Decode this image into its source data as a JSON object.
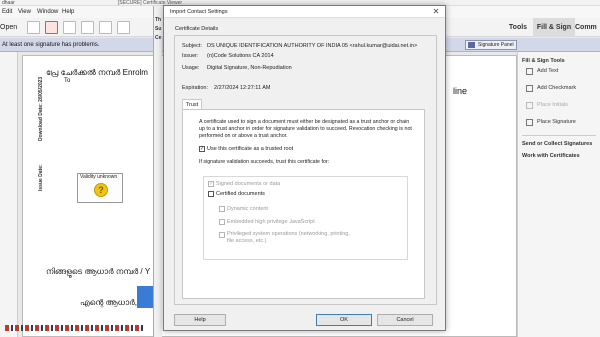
{
  "app": {
    "title_fragment": "dhaar",
    "cert_viewer_fragment": "[SECURE] Certificate Viewer",
    "menu": [
      "Edit",
      "View",
      "Window",
      "Help"
    ],
    "open_label": "Open",
    "tabs": [
      "Tools",
      "Fill & Sign",
      "Comm"
    ],
    "signature_message": "At least one signature has problems.",
    "signature_panel_label": "Signature Panel"
  },
  "document": {
    "header_line": "പ്രേ ചേർക്കൽ നമ്പർ Enrolm",
    "to_label": "To",
    "download_date_label": "Download Date: 28/05/2023",
    "issue_date_label": "Issue Date:",
    "validity_label": "Validity unknown",
    "aadhaar_line": "നിങ്ങളുടെ ആധാർ നമ്പർ / Y",
    "aadhaar_line2": "എന്റെ ആധാർ, എ",
    "right_fragment": "line"
  },
  "background_dialog": {
    "frag_1": "Th",
    "frag_2": "Su",
    "frag_3": "Ce"
  },
  "right_panel": {
    "section_title": "Fill & Sign Tools",
    "items": [
      {
        "label": "Add Text",
        "enabled": true
      },
      {
        "label": "Add Checkmark",
        "enabled": true
      },
      {
        "label": "Place Initials",
        "enabled": false
      },
      {
        "label": "Place Signature",
        "enabled": true
      }
    ],
    "send_label": "Send or Collect Signatures",
    "work_label": "Work with Certificates"
  },
  "dialog": {
    "title": "Import Contact Settings",
    "group_label": "Certificate Details",
    "subject_label": "Subject:",
    "subject_value": "DS UNIQUE IDENTIFICATION AUTHORITY OF INDIA 05 <rahul.kumar@uidai.net.in>",
    "issuer_label": "Issuer:",
    "issuer_value": "(n)Code Solutions CA 2014",
    "usage_label": "Usage:",
    "usage_value": "Digital Signature, Non-Repudiation",
    "expiration_label": "Expiration:",
    "expiration_value": "2/27/2024 12:27:11 AM",
    "trust_tab": "Trust",
    "trust_description": "A certificate used to sign a document must either be designated as a trust anchor or chain up to a trust anchor in order for signature validation to succeed.  Revocation checking is not performed on or above a trust anchor.",
    "use_as_root_label": "Use this certificate as a trusted root",
    "use_as_root_checked": true,
    "if_success_label": "If signature validation succeeds, trust this certificate for:",
    "signed_docs_label": "Signed documents or data",
    "signed_docs_checked": true,
    "certified_docs_label": "Certified documents",
    "certified_docs_checked": false,
    "dynamic_label": "Dynamic content",
    "embedded_js_label": "Embedded high privilege JavaScript",
    "privileged_ops_label": "Privileged system operations (networking, printing, file access, etc.)",
    "help_button": "Help",
    "ok_button": "OK",
    "cancel_button": "Cancel"
  }
}
